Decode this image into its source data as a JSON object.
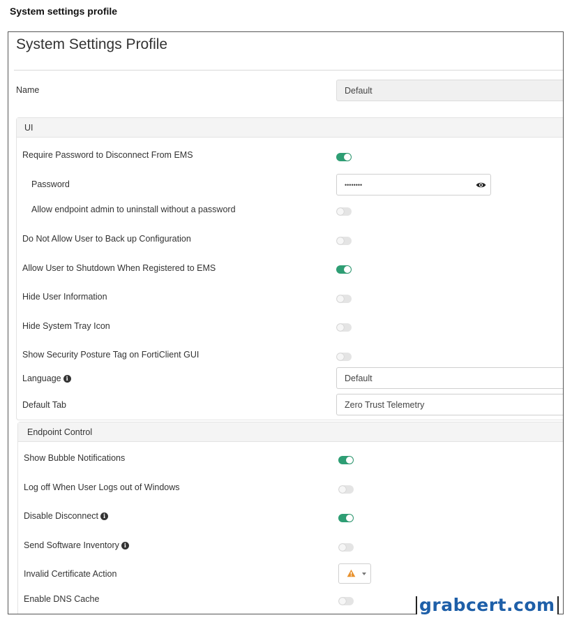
{
  "caption": "System settings profile",
  "profile": {
    "title": "System Settings Profile",
    "name_label": "Name",
    "name_value": "Default"
  },
  "ui_section": {
    "title": "UI",
    "require_password": {
      "label": "Require Password to Disconnect From EMS",
      "on": true
    },
    "password": {
      "label": "Password",
      "value": "••••••••",
      "icon": "eye-icon"
    },
    "allow_uninstall": {
      "label": "Allow endpoint admin to uninstall without a password",
      "on": false
    },
    "no_backup": {
      "label": "Do Not Allow User to Back up Configuration",
      "on": false
    },
    "allow_shutdown": {
      "label": "Allow User to Shutdown When Registered to EMS",
      "on": true
    },
    "hide_user_info": {
      "label": "Hide User Information",
      "on": false
    },
    "hide_tray_icon": {
      "label": "Hide System Tray Icon",
      "on": false
    },
    "show_posture_tag": {
      "label": "Show Security Posture Tag on FortiClient GUI",
      "on": false
    },
    "language": {
      "label": "Language",
      "value": "Default"
    },
    "default_tab": {
      "label": "Default Tab",
      "value": "Zero Trust Telemetry"
    }
  },
  "endpoint_section": {
    "title": "Endpoint Control",
    "bubble_notifications": {
      "label": "Show Bubble Notifications",
      "on": true
    },
    "log_off": {
      "label": "Log off When User Logs out of Windows",
      "on": false
    },
    "disable_disconnect": {
      "label": "Disable Disconnect",
      "on": true
    },
    "software_inventory": {
      "label": "Send Software Inventory",
      "on": false
    },
    "invalid_cert": {
      "label": "Invalid Certificate Action",
      "icon": "warning-icon"
    },
    "dns_cache": {
      "label": "Enable DNS Cache",
      "on": false
    }
  },
  "colors": {
    "toggle_on": "#2e9e74",
    "toggle_off": "#e4e4e4",
    "warning": "#e8912d",
    "watermark": "#1e5fa8"
  },
  "watermark": "grabcert.com"
}
